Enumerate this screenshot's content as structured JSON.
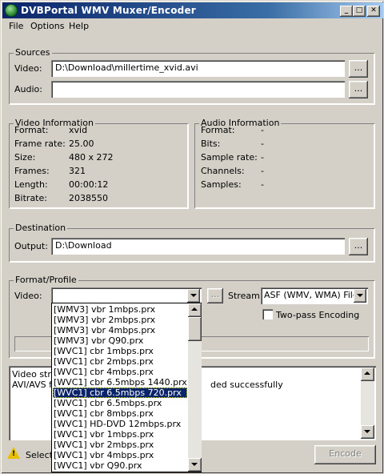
{
  "window": {
    "title": "DVBPortal WMV Muxer/Encoder",
    "buttons": {
      "minimize": "_",
      "maximize": "□",
      "close": "✕"
    }
  },
  "menu": [
    "File",
    "Options",
    "Help"
  ],
  "sources": {
    "legend": "Sources",
    "video_label": "Video:",
    "video_value": "D:\\Download\\millertime_xvid.avi",
    "audio_label": "Audio:",
    "audio_value": "",
    "browse": "..."
  },
  "video_info": {
    "legend": "Video Information",
    "rows": [
      {
        "label": "Format:",
        "value": "xvid"
      },
      {
        "label": "Frame rate:",
        "value": "25.00"
      },
      {
        "label": "Size:",
        "value": "480 x 272"
      },
      {
        "label": "Frames:",
        "value": "321"
      },
      {
        "label": "Length:",
        "value": "00:00:12"
      },
      {
        "label": "Bitrate:",
        "value": "2038550"
      }
    ]
  },
  "audio_info": {
    "legend": "Audio Information",
    "rows": [
      {
        "label": "Format:",
        "value": "-"
      },
      {
        "label": "Bits:",
        "value": "-"
      },
      {
        "label": "Sample rate:",
        "value": "-"
      },
      {
        "label": "Channels:",
        "value": "-"
      },
      {
        "label": "Samples:",
        "value": "-"
      }
    ]
  },
  "destination": {
    "legend": "Destination",
    "output_label": "Output:",
    "output_value": "D:\\Download",
    "browse": "..."
  },
  "format_profile": {
    "legend": "Format/Profile",
    "video_label": "Video:",
    "video_value": "",
    "browse": "...",
    "stream_label": "Stream:",
    "stream_value": "ASF (WMV, WMA) File",
    "two_pass_label": "Two-pass Encoding",
    "two_pass_checked": false
  },
  "log": {
    "line1_start": "Video stre",
    "line2_start": "AVI/AVS f",
    "line2_end": "ded successfully"
  },
  "status": {
    "text": "Select",
    "encode_button": "Encode"
  },
  "dropdown": {
    "selected_index": 8,
    "items": [
      "[WMV3] vbr 1mbps.prx",
      "[WMV3] vbr 2mbps.prx",
      "[WMV3] vbr 4mbps.prx",
      "[WMV3] vbr Q90.prx",
      "[WVC1] cbr 1mbps.prx",
      "[WVC1] cbr 2mbps.prx",
      "[WVC1] cbr 4mbps.prx",
      "[WVC1] cbr 6.5mbps 1440.prx",
      "[WVC1] cbr 6.5mbps 720.prx",
      "[WVC1] cbr 6.5mbps.prx",
      "[WVC1] cbr 8mbps.prx",
      "[WVC1] HD-DVD 12mbps.prx",
      "[WVC1] vbr 1mbps.prx",
      "[WVC1] vbr 2mbps.prx",
      "[WVC1] vbr 4mbps.prx",
      "[WVC1] vbr Q90.prx"
    ]
  }
}
